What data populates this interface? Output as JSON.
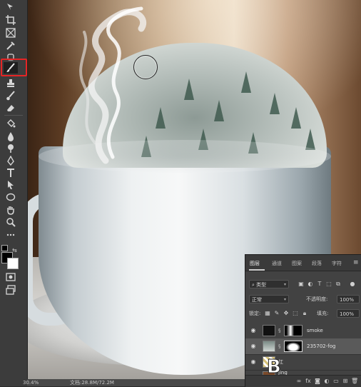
{
  "status_bar": {
    "zoom": "30.4%",
    "doc_info": "文档:28.8M/72.2M"
  },
  "layers_panel": {
    "tabs": [
      {
        "label": "图层",
        "active": true
      },
      {
        "label": "通道",
        "active": false
      },
      {
        "label": "图案",
        "active": false
      },
      {
        "label": "段落",
        "active": false
      },
      {
        "label": "字符",
        "active": false
      }
    ],
    "filter_kind": "类型",
    "blend_mode": "正常",
    "opacity_label": "不透明度:",
    "opacity_value": "100%",
    "lock_label": "锁定:",
    "fill_label": "填充:",
    "fill_value": "100%",
    "layers": [
      {
        "name": "smoke",
        "visible": true,
        "selected": false,
        "has_mask": true
      },
      {
        "name": "235702-fog",
        "visible": true,
        "selected": true,
        "has_mask": true
      },
      {
        "name": "红",
        "visible": true,
        "selected": false,
        "has_mask": false
      },
      {
        "name": "jing",
        "visible": false,
        "selected": false,
        "has_mask": false
      }
    ]
  },
  "toolbar": {
    "active_tool": "brush-tool",
    "tools": [
      "move-tool",
      "crop-tool",
      "frame-tool",
      "eyedropper-tool",
      "brush-tool",
      "stamp-tool",
      "history-brush-tool",
      "eraser-tool",
      "paint-bucket-tool",
      "blur-tool",
      "dodge-tool",
      "pen-tool",
      "type-tool",
      "path-selection-tool",
      "shape-tool",
      "hand-tool",
      "zoom-tool",
      "more-tools"
    ]
  },
  "watermark_text": "B"
}
